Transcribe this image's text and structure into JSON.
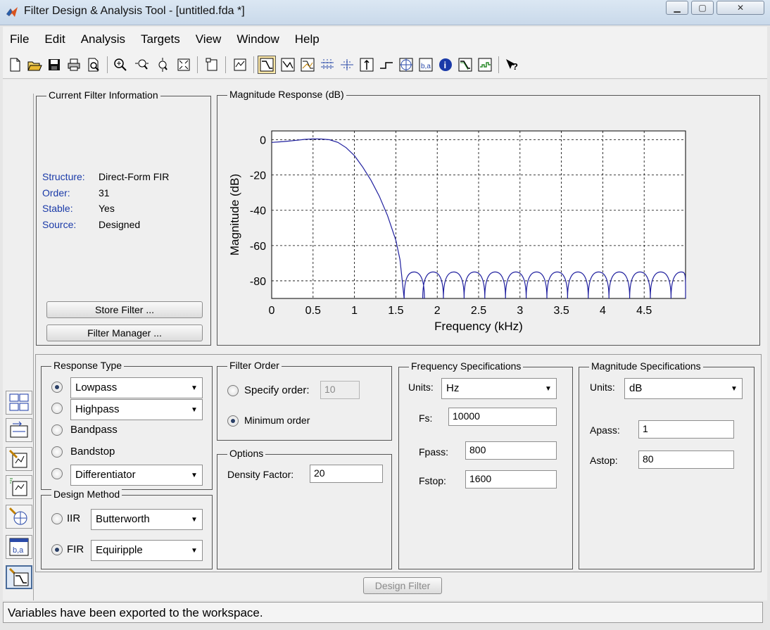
{
  "window": {
    "title": "Filter Design & Analysis Tool -  [untitled.fda *]",
    "buttons": [
      "minimize",
      "maximize",
      "close"
    ]
  },
  "menu": [
    "File",
    "Edit",
    "Analysis",
    "Targets",
    "View",
    "Window",
    "Help"
  ],
  "toolbar": {
    "icons": [
      "new-icon",
      "open-icon",
      "save-icon",
      "print-icon",
      "print-preview-icon",
      "zoom-in-icon",
      "zoom-x-icon",
      "zoom-y-icon",
      "full-view-icon",
      "new-figure-icon",
      "full-view-analysis-icon",
      "magnitude-response-icon",
      "phase-response-icon",
      "magnitude-phase-icon",
      "group-delay-icon",
      "phase-delay-icon",
      "impulse-response-icon",
      "step-response-icon",
      "pole-zero-icon",
      "filter-coefficients-icon",
      "filter-info-icon",
      "magnitude-estimate-icon",
      "round-off-noise-icon",
      "whats-this-icon"
    ]
  },
  "current_filter": {
    "title": "Current Filter Information",
    "rows": [
      {
        "label": "Structure:",
        "value": "Direct-Form FIR"
      },
      {
        "label": "Order:",
        "value": "31"
      },
      {
        "label": "Stable:",
        "value": "Yes"
      },
      {
        "label": "Source:",
        "value": "Designed"
      }
    ],
    "store_button": "Store Filter ...",
    "manager_button": "Filter Manager ..."
  },
  "plot": {
    "title": "Magnitude Response (dB)"
  },
  "chart_data": {
    "type": "line",
    "xlabel": "Frequency (kHz)",
    "ylabel": "Magnitude (dB)",
    "xlim": [
      0,
      5
    ],
    "ylim": [
      -90,
      5
    ],
    "xticks": [
      "0",
      "0.5",
      "1",
      "1.5",
      "2",
      "2.5",
      "3",
      "3.5",
      "4",
      "4.5"
    ],
    "xtick_values": [
      0,
      0.5,
      1,
      1.5,
      2,
      2.5,
      3,
      3.5,
      4,
      4.5
    ],
    "yticks": [
      "0",
      "-20",
      "-40",
      "-60",
      "-80"
    ],
    "ytick_values": [
      0,
      -20,
      -40,
      -60,
      -80
    ],
    "grid": true,
    "line_color": "#1f1f9e",
    "passband": {
      "x": [
        0,
        0.1,
        0.2,
        0.3,
        0.4,
        0.5,
        0.6,
        0.7,
        0.8,
        0.9,
        1.0,
        1.1,
        1.2,
        1.3,
        1.4,
        1.5,
        1.55,
        1.6
      ],
      "y": [
        -1.5,
        -1.2,
        -0.8,
        -0.3,
        0.2,
        0.5,
        0.4,
        0,
        -1.5,
        -4.5,
        -9,
        -15.5,
        -23,
        -32,
        -43,
        -57,
        -68,
        -90
      ]
    },
    "stopband": {
      "lobe_tops_khz": [
        1.72,
        1.95,
        2.2,
        2.45,
        2.7,
        2.95,
        3.2,
        3.45,
        3.7,
        3.95,
        4.2,
        4.45,
        4.7,
        4.95
      ],
      "lobe_peak_db": -75,
      "null_db": -90
    }
  },
  "response_type": {
    "title": "Response Type",
    "lowpass": "Lowpass",
    "highpass": "Highpass",
    "bandpass": "Bandpass",
    "bandstop": "Bandstop",
    "differentiator": "Differentiator"
  },
  "design_method": {
    "title": "Design Method",
    "iir_label": "IIR",
    "iir_value": "Butterworth",
    "fir_label": "FIR",
    "fir_value": "Equiripple"
  },
  "filter_order": {
    "title": "Filter Order",
    "specify_label": "Specify order:",
    "specify_value": "10",
    "minimum_label": "Minimum order"
  },
  "options": {
    "title": "Options",
    "density_label": "Density Factor:",
    "density_value": "20"
  },
  "frequency_specs": {
    "title": "Frequency Specifications",
    "units_label": "Units:",
    "units_value": "Hz",
    "fs_label": "Fs:",
    "fs_value": "10000",
    "fpass_label": "Fpass:",
    "fpass_value": "800",
    "fstop_label": "Fstop:",
    "fstop_value": "1600"
  },
  "magnitude_specs": {
    "title": "Magnitude Specifications",
    "units_label": "Units:",
    "units_value": "dB",
    "apass_label": "Apass:",
    "apass_value": "1",
    "astop_label": "Astop:",
    "astop_value": "80"
  },
  "design_button": "Design Filter",
  "status": "Variables have been exported to the workspace."
}
